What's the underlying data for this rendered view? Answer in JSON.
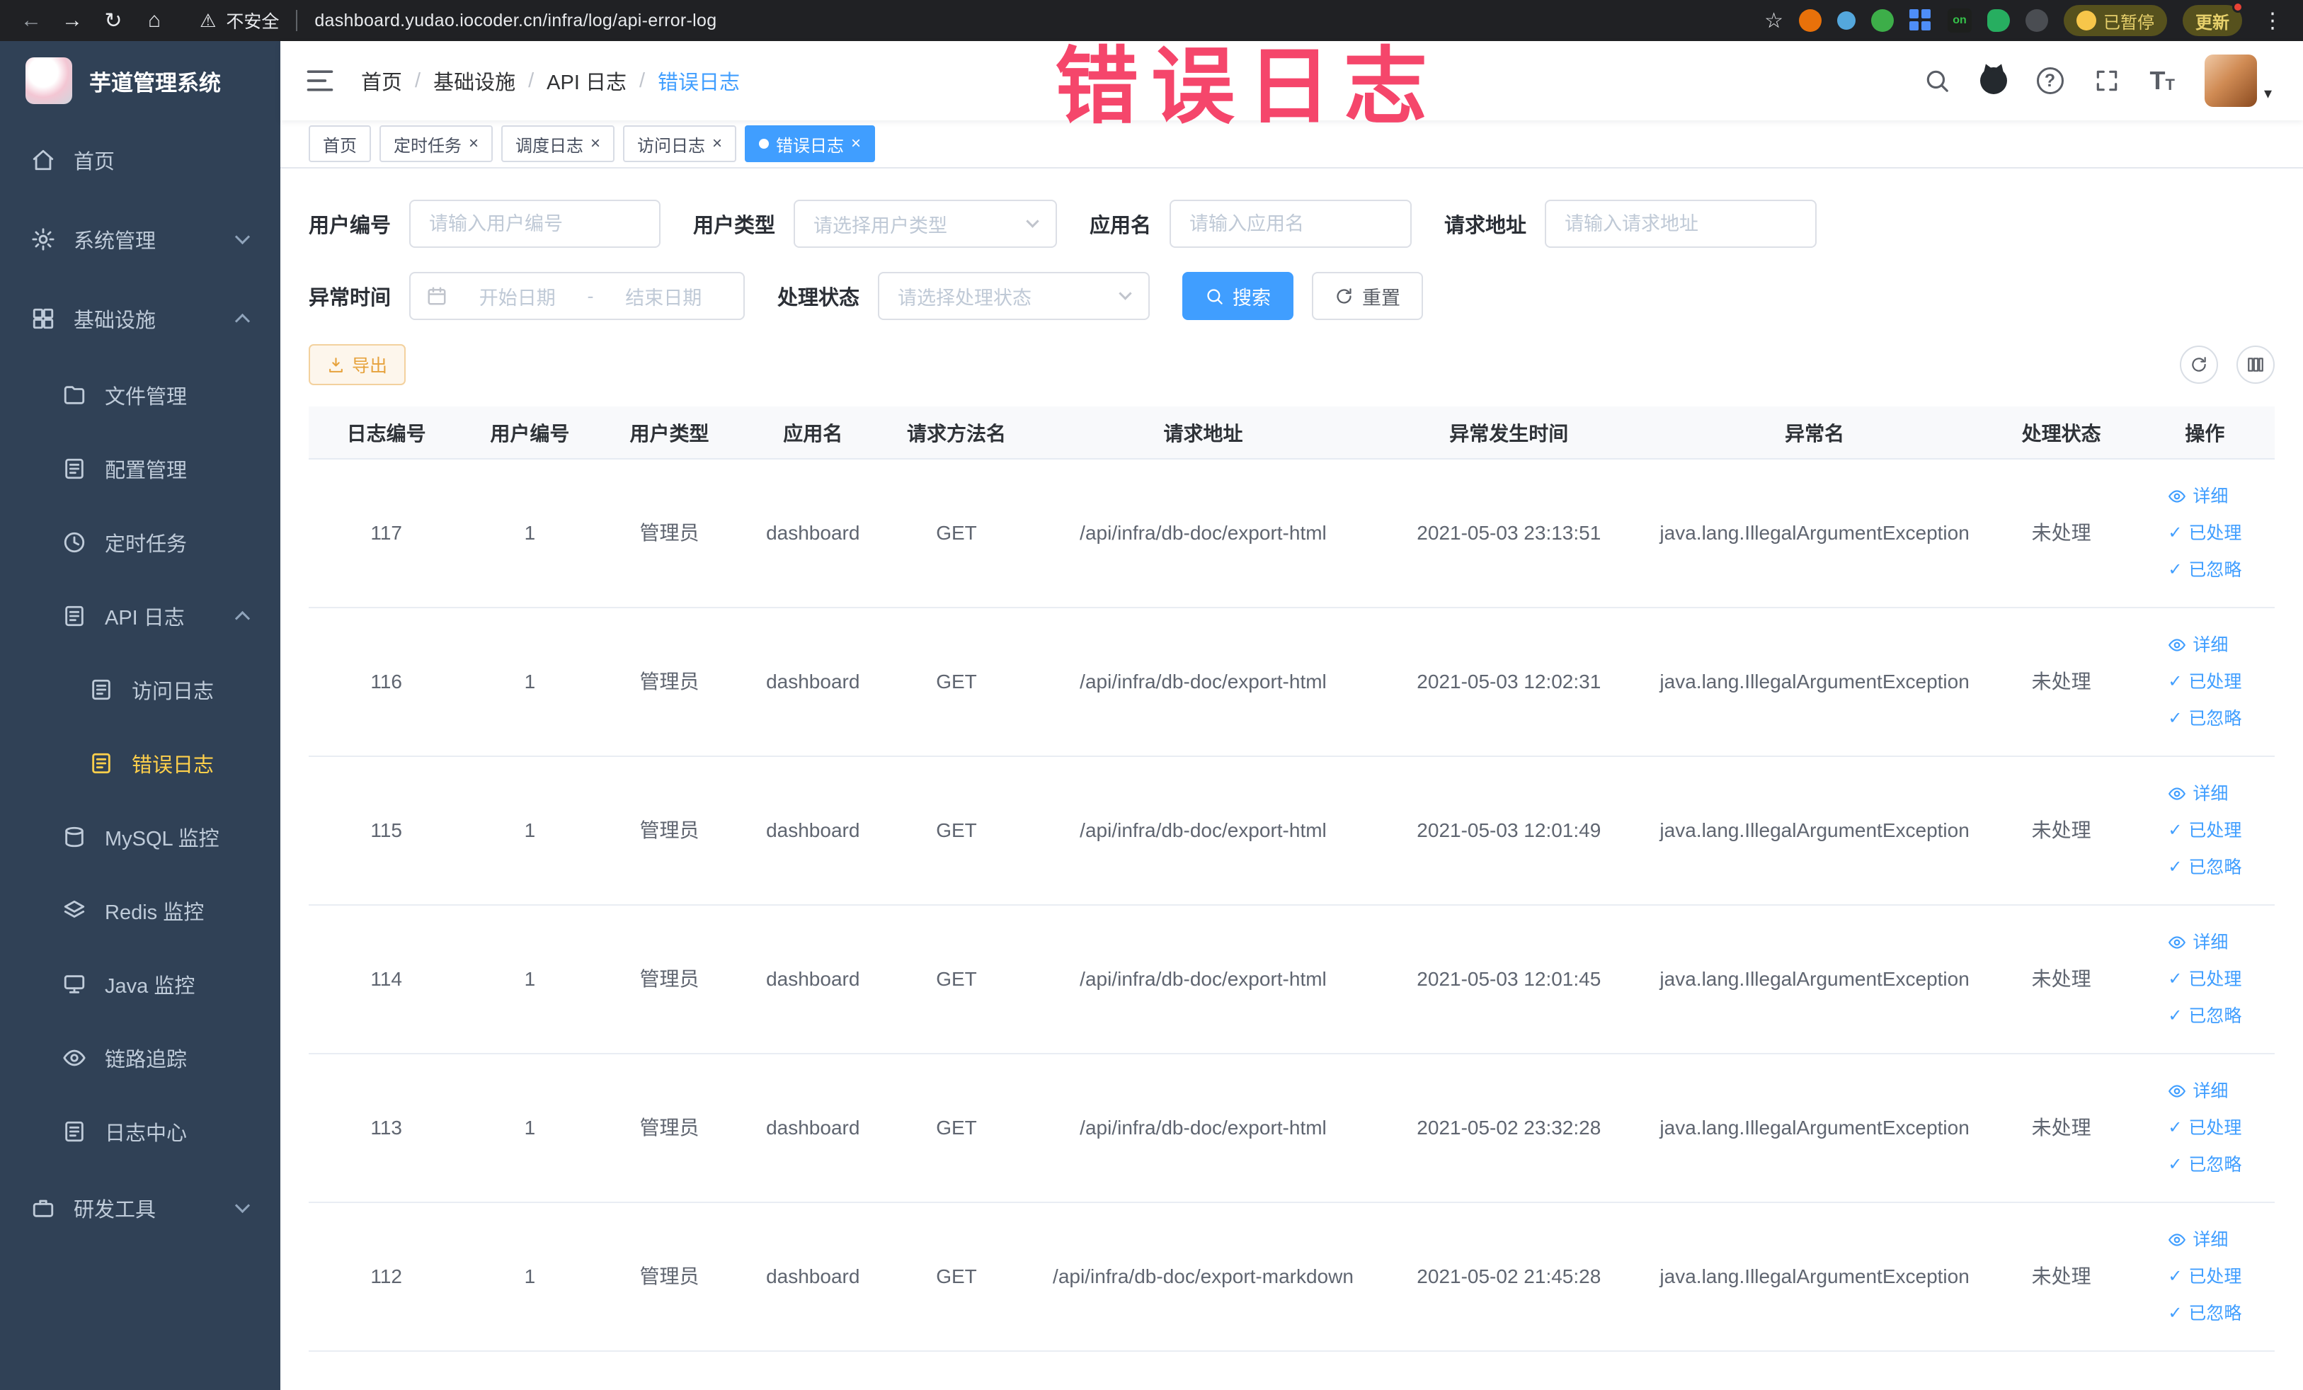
{
  "icons": {
    "back": "←",
    "forward": "→",
    "reload": "↻",
    "home": "⌂",
    "warning": "⚠",
    "star": "☆",
    "kebab": "⋮",
    "close": "×",
    "check": "✓",
    "question": "?",
    "caret_down": "▾",
    "breadcrumb_separator": "/",
    "font_letter": "T"
  },
  "browser": {
    "security_label": "不安全",
    "url": "dashboard.yudao.iocoder.cn/infra/log/api-error-log",
    "extension_on_label": "on",
    "paused_label": "已暂停",
    "update_label": "更新"
  },
  "watermark": "错误日志",
  "sidebar": {
    "logo_title": "芋道管理系统",
    "items": [
      "首页",
      "系统管理",
      "基础设施",
      "文件管理",
      "配置管理",
      "定时任务",
      "API 日志",
      "访问日志",
      "错误日志",
      "MySQL 监控",
      "Redis 监控",
      "Java 监控",
      "链路追踪",
      "日志中心",
      "研发工具"
    ]
  },
  "breadcrumb": [
    "首页",
    "基础设施",
    "API 日志",
    "错误日志"
  ],
  "tabs": [
    "首页",
    "定时任务",
    "调度日志",
    "访问日志",
    "错误日志"
  ],
  "filters": {
    "user_id": {
      "label": "用户编号",
      "placeholder": "请输入用户编号"
    },
    "user_type": {
      "label": "用户类型",
      "placeholder": "请选择用户类型"
    },
    "app_name": {
      "label": "应用名",
      "placeholder": "请输入应用名"
    },
    "request_url": {
      "label": "请求地址",
      "placeholder": "请输入请求地址"
    },
    "exception_time": {
      "label": "异常时间",
      "start_placeholder": "开始日期",
      "separator": "-",
      "end_placeholder": "结束日期"
    },
    "process_status": {
      "label": "处理状态",
      "placeholder": "请选择处理状态"
    },
    "search_label": "搜索",
    "reset_label": "重置"
  },
  "toolbar": {
    "export_label": "导出"
  },
  "table": {
    "columns": [
      "日志编号",
      "用户编号",
      "用户类型",
      "应用名",
      "请求方法名",
      "请求地址",
      "异常发生时间",
      "异常名",
      "处理状态",
      "操作"
    ],
    "actions": [
      "详细",
      "已处理",
      "已忽略"
    ],
    "rows": [
      {
        "id": "117",
        "user_id": "1",
        "user_type": "管理员",
        "app": "dashboard",
        "method": "GET",
        "url": "/api/infra/db-doc/export-html",
        "time": "2021-05-03 23:13:51",
        "exception": "java.lang.IllegalArgumentException",
        "status": "未处理"
      },
      {
        "id": "116",
        "user_id": "1",
        "user_type": "管理员",
        "app": "dashboard",
        "method": "GET",
        "url": "/api/infra/db-doc/export-html",
        "time": "2021-05-03 12:02:31",
        "exception": "java.lang.IllegalArgumentException",
        "status": "未处理"
      },
      {
        "id": "115",
        "user_id": "1",
        "user_type": "管理员",
        "app": "dashboard",
        "method": "GET",
        "url": "/api/infra/db-doc/export-html",
        "time": "2021-05-03 12:01:49",
        "exception": "java.lang.IllegalArgumentException",
        "status": "未处理"
      },
      {
        "id": "114",
        "user_id": "1",
        "user_type": "管理员",
        "app": "dashboard",
        "method": "GET",
        "url": "/api/infra/db-doc/export-html",
        "time": "2021-05-03 12:01:45",
        "exception": "java.lang.IllegalArgumentException",
        "status": "未处理"
      },
      {
        "id": "113",
        "user_id": "1",
        "user_type": "管理员",
        "app": "dashboard",
        "method": "GET",
        "url": "/api/infra/db-doc/export-html",
        "time": "2021-05-02 23:32:28",
        "exception": "java.lang.IllegalArgumentException",
        "status": "未处理"
      },
      {
        "id": "112",
        "user_id": "1",
        "user_type": "管理员",
        "app": "dashboard",
        "method": "GET",
        "url": "/api/infra/db-doc/export-markdown",
        "time": "2021-05-02 21:45:28",
        "exception": "java.lang.IllegalArgumentException",
        "status": "未处理"
      }
    ]
  }
}
